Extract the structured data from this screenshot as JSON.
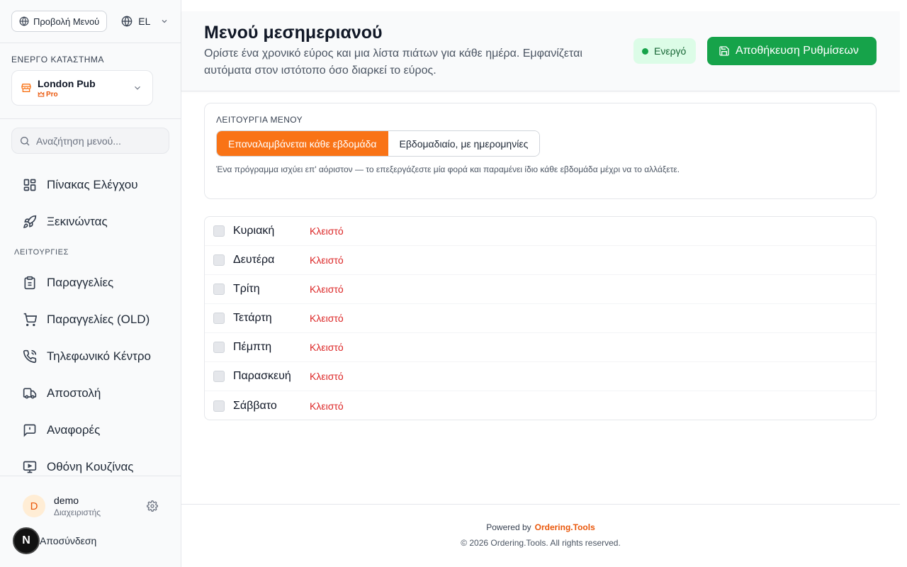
{
  "sidebar": {
    "menu_view_label": "Προβολή Μενού",
    "language": "EL",
    "store_section_label": "ΕΝΕΡΓΟ ΚΑΤΑΣΤΗΜΑ",
    "store_name": "London Pub",
    "store_plan": "Pro",
    "search_placeholder": "Αναζήτηση μενού...",
    "nav_top": [
      {
        "label": "Πίνακας Ελέγχου",
        "icon": "dashboard-icon"
      },
      {
        "label": "Ξεκινώντας",
        "icon": "rocket-icon"
      }
    ],
    "section_label": "ΛΕΙΤΟΥΡΓΙΕΣ",
    "nav_ops": [
      {
        "label": "Παραγγελίες",
        "icon": "clipboard-icon"
      },
      {
        "label": "Παραγγελίες (OLD)",
        "icon": "cart-icon"
      },
      {
        "label": "Τηλεφωνικό Κέντρο",
        "icon": "phone-icon"
      },
      {
        "label": "Αποστολή",
        "icon": "truck-icon"
      },
      {
        "label": "Αναφορές",
        "icon": "report-icon"
      },
      {
        "label": "Οθόνη Κουζίνας",
        "icon": "monitor-icon"
      }
    ],
    "user": {
      "initial": "D",
      "name": "demo",
      "role": "Διαχειριστής"
    },
    "logout_label": "Αποσύνδεση",
    "badge_letter": "N"
  },
  "header": {
    "title": "Μενού μεσημεριανού",
    "description": "Ορίστε ένα χρονικό εύρος και μια λίστα πιάτων για κάθε ημέρα. Εμφανίζεται αυτόματα στον ιστότοπο όσο διαρκεί το εύρος.",
    "status": "Ενεργό",
    "save_label": "Αποθήκευση Ρυθμίσεων"
  },
  "mode": {
    "label": "ΛΕΙΤΟΥΡΓΙΑ ΜΕΝΟΥ",
    "options": [
      "Επαναλαμβάνεται κάθε εβδομάδα",
      "Εβδομαδιαίο, με ημερομηνίες"
    ],
    "selected": "Επαναλαμβάνεται κάθε εβδομάδα",
    "help": "Ένα πρόγραμμα ισχύει επ' αόριστον — το επεξεργάζεστε μία φορά και παραμένει ίδιο κάθε εβδομάδα μέχρι να το αλλάξετε."
  },
  "days": [
    {
      "name": "Κυριακή",
      "status": "Κλειστό"
    },
    {
      "name": "Δευτέρα",
      "status": "Κλειστό"
    },
    {
      "name": "Τρίτη",
      "status": "Κλειστό"
    },
    {
      "name": "Τετάρτη",
      "status": "Κλειστό"
    },
    {
      "name": "Πέμπτη",
      "status": "Κλειστό"
    },
    {
      "name": "Παρασκευή",
      "status": "Κλειστό"
    },
    {
      "name": "Σάββατο",
      "status": "Κλειστό"
    }
  ],
  "footer": {
    "powered_by": "Powered by",
    "brand": "Ordering.Tools",
    "copyright": "© 2026 Ordering.Tools. All rights reserved."
  },
  "colors": {
    "accent": "#f97316",
    "success": "#16a34a",
    "closed": "#dc2626"
  }
}
